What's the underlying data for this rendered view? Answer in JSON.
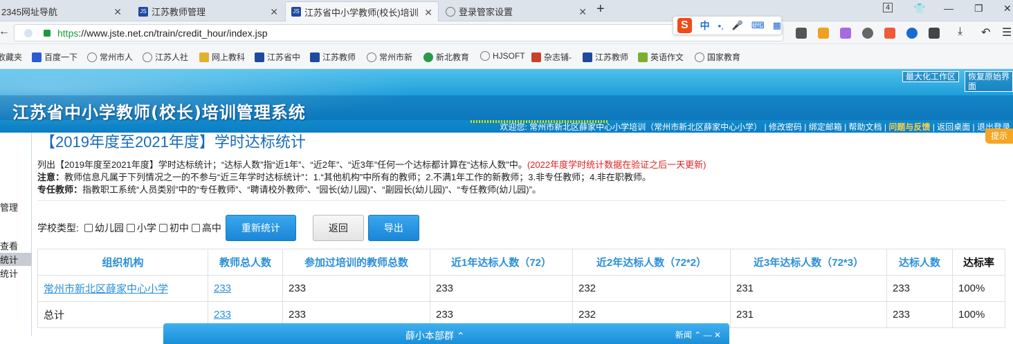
{
  "browser": {
    "tabs": [
      {
        "title": "2345网址导航",
        "icon": "globe-icon"
      },
      {
        "title": "江苏教师管理",
        "icon": "jste-logo-icon"
      },
      {
        "title": "江苏省中小学教师(校长)培训",
        "icon": "jste-logo-icon"
      },
      {
        "title": "登录管家设置",
        "icon": "globe-icon"
      }
    ],
    "tab_counter": "4",
    "new_tab": "+",
    "url_https": "https",
    "url_rest": "://www.jste.net.cn/train/credit_hour/index.jsp",
    "ime": {
      "logo": "S",
      "mode": "中",
      "punct": "•,"
    },
    "bookmarks": [
      {
        "label": "收藏夹",
        "icon": "star-icon"
      },
      {
        "label": "百度一下",
        "icon": "baidu-icon"
      },
      {
        "label": "常州市人",
        "icon": "globe-icon"
      },
      {
        "label": "江苏人社",
        "icon": "globe-icon"
      },
      {
        "label": "网上教科",
        "icon": "globe-icon"
      },
      {
        "label": "江苏省中",
        "icon": "jste-logo-icon"
      },
      {
        "label": "江苏教师",
        "icon": "jste-logo-icon"
      },
      {
        "label": "常州市新",
        "icon": "globe-icon"
      },
      {
        "label": "新北教育",
        "icon": "globe-icon"
      },
      {
        "label": "HJSOFT",
        "icon": "globe-icon"
      },
      {
        "label": "杂志铺-",
        "icon": "globe-icon"
      },
      {
        "label": "江苏教师",
        "icon": "jste-logo-icon"
      },
      {
        "label": "英语作文",
        "icon": "globe-icon"
      },
      {
        "label": "国家教育",
        "icon": "globe-icon"
      }
    ]
  },
  "header": {
    "title": "江苏省中小学教师(校长)培训管理系统",
    "maximize": "最大化工作区",
    "restore": "恢复原始界面",
    "welcome": "欢迎您: 常州市新北区薛家中心小学培训（常州市新北区薛家中心小学）",
    "links": [
      "修改密码",
      "绑定邮箱",
      "帮助文档",
      "问题与反馈",
      "返回桌面",
      "退出登录"
    ]
  },
  "sidebar": {
    "items": [
      "管理",
      "查看",
      "统计",
      "统计"
    ]
  },
  "main": {
    "title": "【2019年度至2021年度】学时达标统计",
    "help_button": "提示",
    "note1": "列出【2019年度至2021年度】学时达标统计；“达标人数”指“近1年”、“近2年”、“近3年”任何一个达标都计算在“达标人数”中。",
    "note1_red": "(2022年度学时统计数据在验证之后一天更新)",
    "note2_label": "注意：",
    "note2": "教师信息凡属于下列情况之一的不参与“近三年学时达标统计”：1.“其他机构”中所有的教师；2.不满1年工作的新教师；3.非专任教师；4.非在职教师。",
    "note3_label": "专任教师：",
    "note3": "指教职工系统“人员类别”中的“专任教师”、“聘请校外教师”、“园长(幼儿园)”、“副园长(幼儿园)”、“专任教师(幼儿园)”。",
    "filter": {
      "label": "学校类型:",
      "options": [
        "幼儿园",
        "小学",
        "初中",
        "高中"
      ],
      "recount": "重新统计",
      "back": "返回",
      "export": "导出"
    },
    "table": {
      "headers": [
        "组织机构",
        "教师总人数",
        "参加过培训的教师总数",
        "近1年达标人数（72）",
        "近2年达标人数（72*2）",
        "近3年达标人数（72*3）",
        "达标人数",
        "达标率"
      ],
      "rows": [
        [
          "常州市新北区薛家中心小学",
          "233",
          "233",
          "233",
          "232",
          "231",
          "233",
          "100%"
        ],
        [
          "总计",
          "233",
          "233",
          "233",
          "232",
          "231",
          "233",
          "100%"
        ]
      ]
    }
  },
  "popup": {
    "title": "薛小本部群 ⌃",
    "controls": "新闻 ⌃  —  ✕"
  }
}
